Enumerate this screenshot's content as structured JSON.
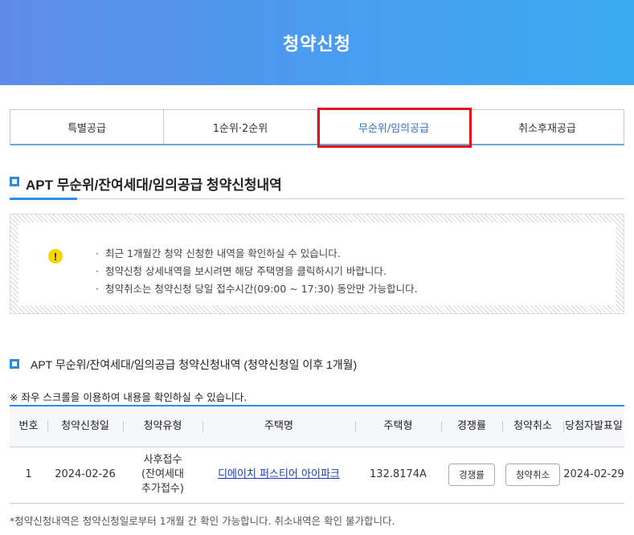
{
  "header": {
    "title": "청약신청"
  },
  "tabs": [
    {
      "label": "특별공급"
    },
    {
      "label": "1순위·2순위"
    },
    {
      "label": "무순위/임의공급"
    },
    {
      "label": "취소후재공급"
    }
  ],
  "section": {
    "title": "APT 무순위/잔여세대/임의공급 청약신청내역"
  },
  "notice": {
    "items": [
      "최근 1개월간 청약 신청한 내역을 확인하실 수 있습니다.",
      "청약신청 상세내역을 보시려면 해당 주택명을 클릭하시기 바랍니다.",
      "청약취소는 청약신청 당일 접수시간(09:00 ~ 17:30) 동안만 가능합니다."
    ]
  },
  "sub_section": {
    "title": "APT 무순위/잔여세대/임의공급 청약신청내역 (청약신청일 이후 1개월)"
  },
  "scroll_note": "※ 좌우 스크롤을 이용하여 내용을 확인하실 수 있습니다.",
  "table": {
    "headers": [
      "번호",
      "청약신청일",
      "청약유형",
      "주택명",
      "주택형",
      "경쟁률",
      "청약취소",
      "당첨자발표일"
    ],
    "rows": [
      {
        "no": "1",
        "date": "2024-02-26",
        "type_line1": "사후접수",
        "type_line2": "(잔여세대",
        "type_line3": "추가접수)",
        "house": "디에이치 퍼스티어 아이파크",
        "house_type": "132.8174A",
        "competition_button": "경쟁률",
        "cancel_button": "청약취소",
        "announce_date": "2024-02-29"
      }
    ]
  },
  "footnote": "*청약신청내역은 청약신청일로부터 1개월 간 확인 가능합니다. 취소내역은 확인 불가합니다.",
  "colors": {
    "accent": "#2e8de6",
    "highlight_box": "#e2121b",
    "header_gradient_start": "#5f8be8",
    "header_gradient_end": "#3aaaf2"
  }
}
